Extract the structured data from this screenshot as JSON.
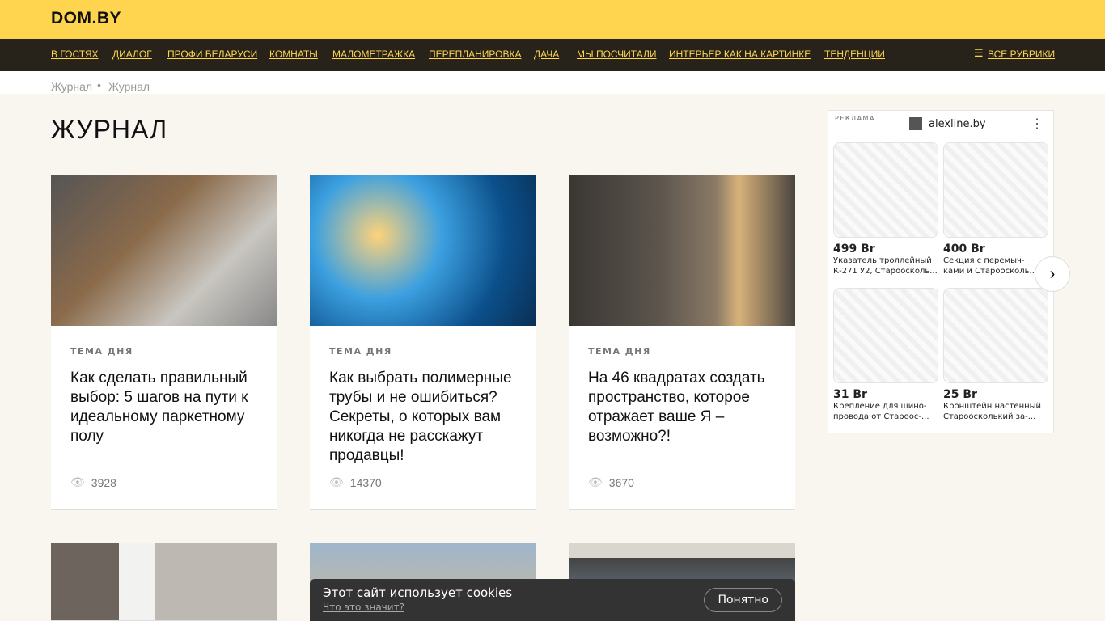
{
  "logo": "DOM.BY",
  "nav": [
    "В ГОСТЯХ",
    "ДИАЛОГ",
    "ПРОФИ БЕЛАРУСИ",
    "КОМНАТЫ",
    "МАЛОМЕТРАЖКА",
    "ПЕРЕПЛАНИРОВКА",
    "ДАЧА",
    "МЫ ПОСЧИТАЛИ",
    "ИНТЕРЬЕР КАК НА КАРТИНКЕ",
    "ТЕНДЕНЦИИ"
  ],
  "all_rubrics": "ВСЕ РУБРИКИ",
  "breadcrumb": [
    "Журнал",
    "Журнал"
  ],
  "page_title": "ЖУРНАЛ",
  "cards": [
    {
      "tag": "ТЕМА ДНЯ",
      "title": "Как сделать правильный выбор: 5 шагов на пути к идеальному паркетному полу",
      "views": "3928"
    },
    {
      "tag": "ТЕМА ДНЯ",
      "title": "Как выбрать полимерные трубы и не ошибиться? Секреты, о которых вам никогда не расскажут продавцы!",
      "views": "14370"
    },
    {
      "tag": "ТЕМА ДНЯ",
      "title": "На 46 квадратах создать пространство, которое отражает ваше Я – возможно?!",
      "views": "3670"
    }
  ],
  "ad": {
    "label": "РЕКЛАМА",
    "brand": "alexline.by",
    "products": [
      {
        "price": "499 Br",
        "desc1": "Указатель троллейный",
        "desc2": "К-271 У2, Староосколь..."
      },
      {
        "price": "400 Br",
        "desc1": "Секция с перемыч-",
        "desc2": "ками и Староосколь..."
      },
      {
        "price": "31 Br",
        "desc1": "Крепление для шино-",
        "desc2": "провода от Староос-..."
      },
      {
        "price": "25 Br",
        "desc1": "Кронштейн настенный",
        "desc2": "Староосколький за-..."
      }
    ]
  },
  "cookie": {
    "text": "Этот сайт использует cookies",
    "link": "Что это значит?",
    "button": "Понятно"
  }
}
